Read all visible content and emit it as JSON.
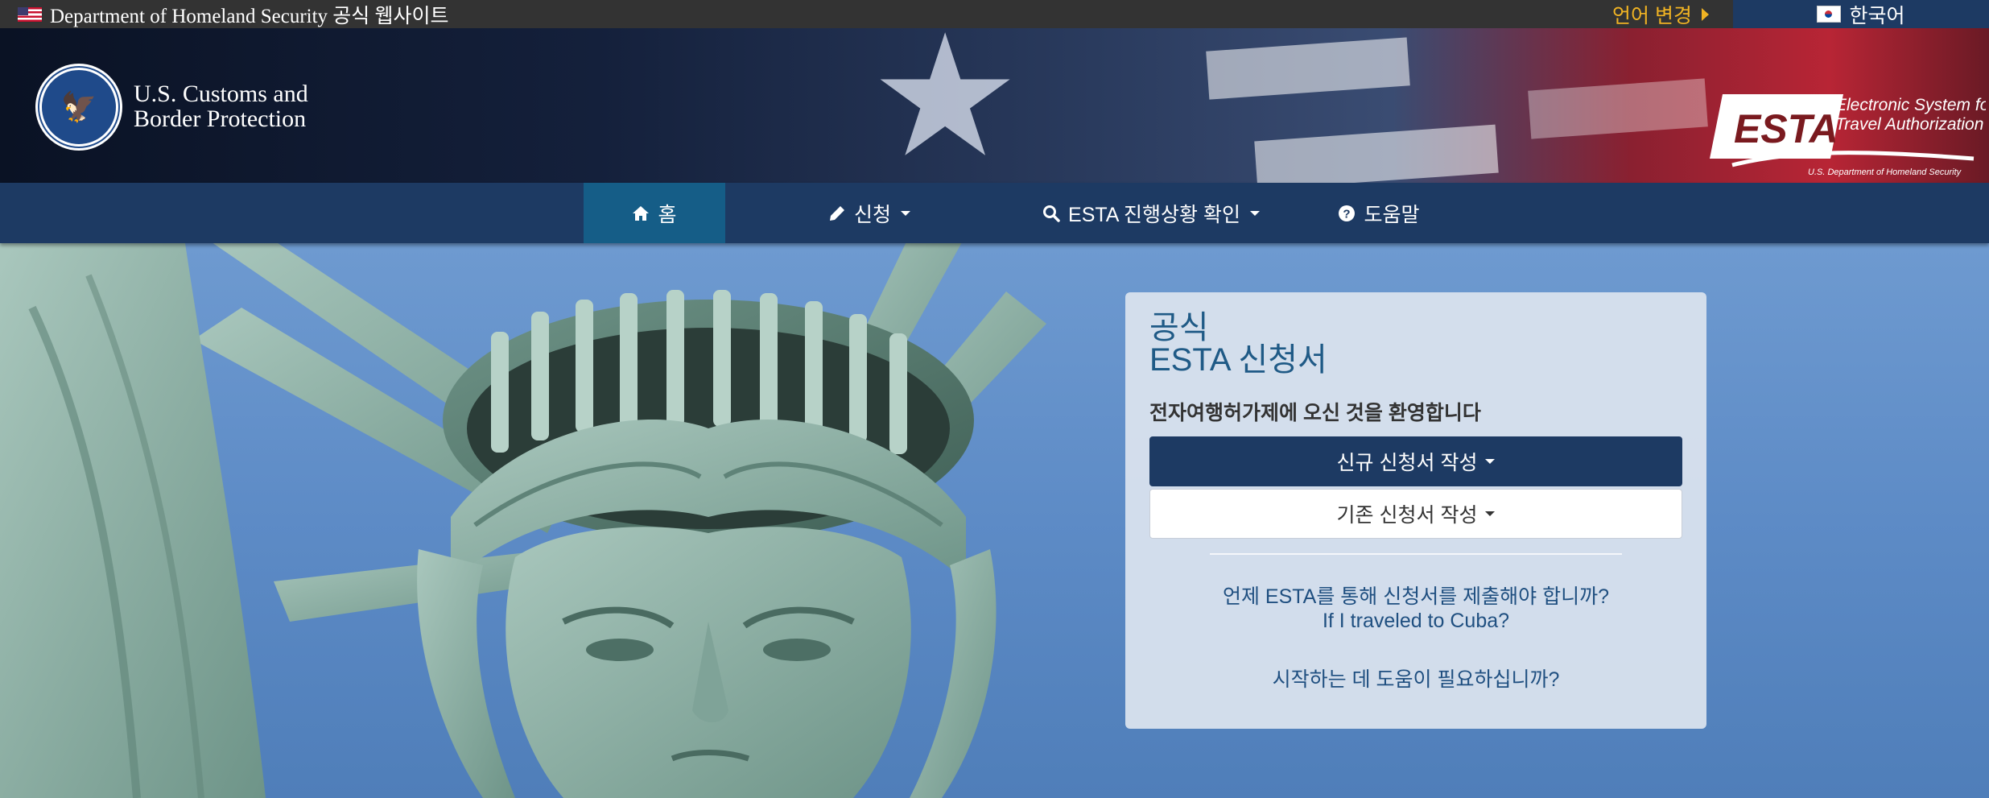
{
  "topbar": {
    "official_site": "Department of Homeland Security 공식 웹사이트",
    "language_change": "언어 변경",
    "current_language": "한국어"
  },
  "header": {
    "agency_name_line1": "U.S. Customs and",
    "agency_name_line2": "Border Protection",
    "esta_logo": {
      "mark": "ESTA",
      "line1": "Electronic System for",
      "line2": "Travel Authorization",
      "line3": "U.S. Department of Homeland Security"
    }
  },
  "nav": {
    "items": [
      {
        "label": "홈",
        "icon": "home-icon",
        "dropdown": false,
        "active": true
      },
      {
        "label": "신청",
        "icon": "pencil-icon",
        "dropdown": true,
        "active": false
      },
      {
        "label": "ESTA 진행상황 확인",
        "icon": "search-icon",
        "dropdown": true,
        "active": false
      },
      {
        "label": "도움말",
        "icon": "question-circle-icon",
        "dropdown": false,
        "active": false
      }
    ]
  },
  "panel": {
    "title_line1": "공식",
    "title_line2": "ESTA 신청서",
    "welcome": "전자여행허가제에 오신 것을 환영합니다",
    "new_application": "신규 신청서 작성",
    "existing_application": "기존 신청서 작성",
    "link_when_submit": "언제 ESTA를 통해 신청서를 제출해야 합니까?",
    "link_cuba": "If I traveled to Cuba?",
    "link_help": "시작하는 데 도움이 필요하십니까?"
  },
  "colors": {
    "topbar_bg": "#333333",
    "nav_bg": "#1d3a63",
    "nav_active_bg": "#155d87",
    "accent_gold": "#f0b323",
    "link_blue": "#1f4f80",
    "title_blue": "#1f5a86"
  }
}
